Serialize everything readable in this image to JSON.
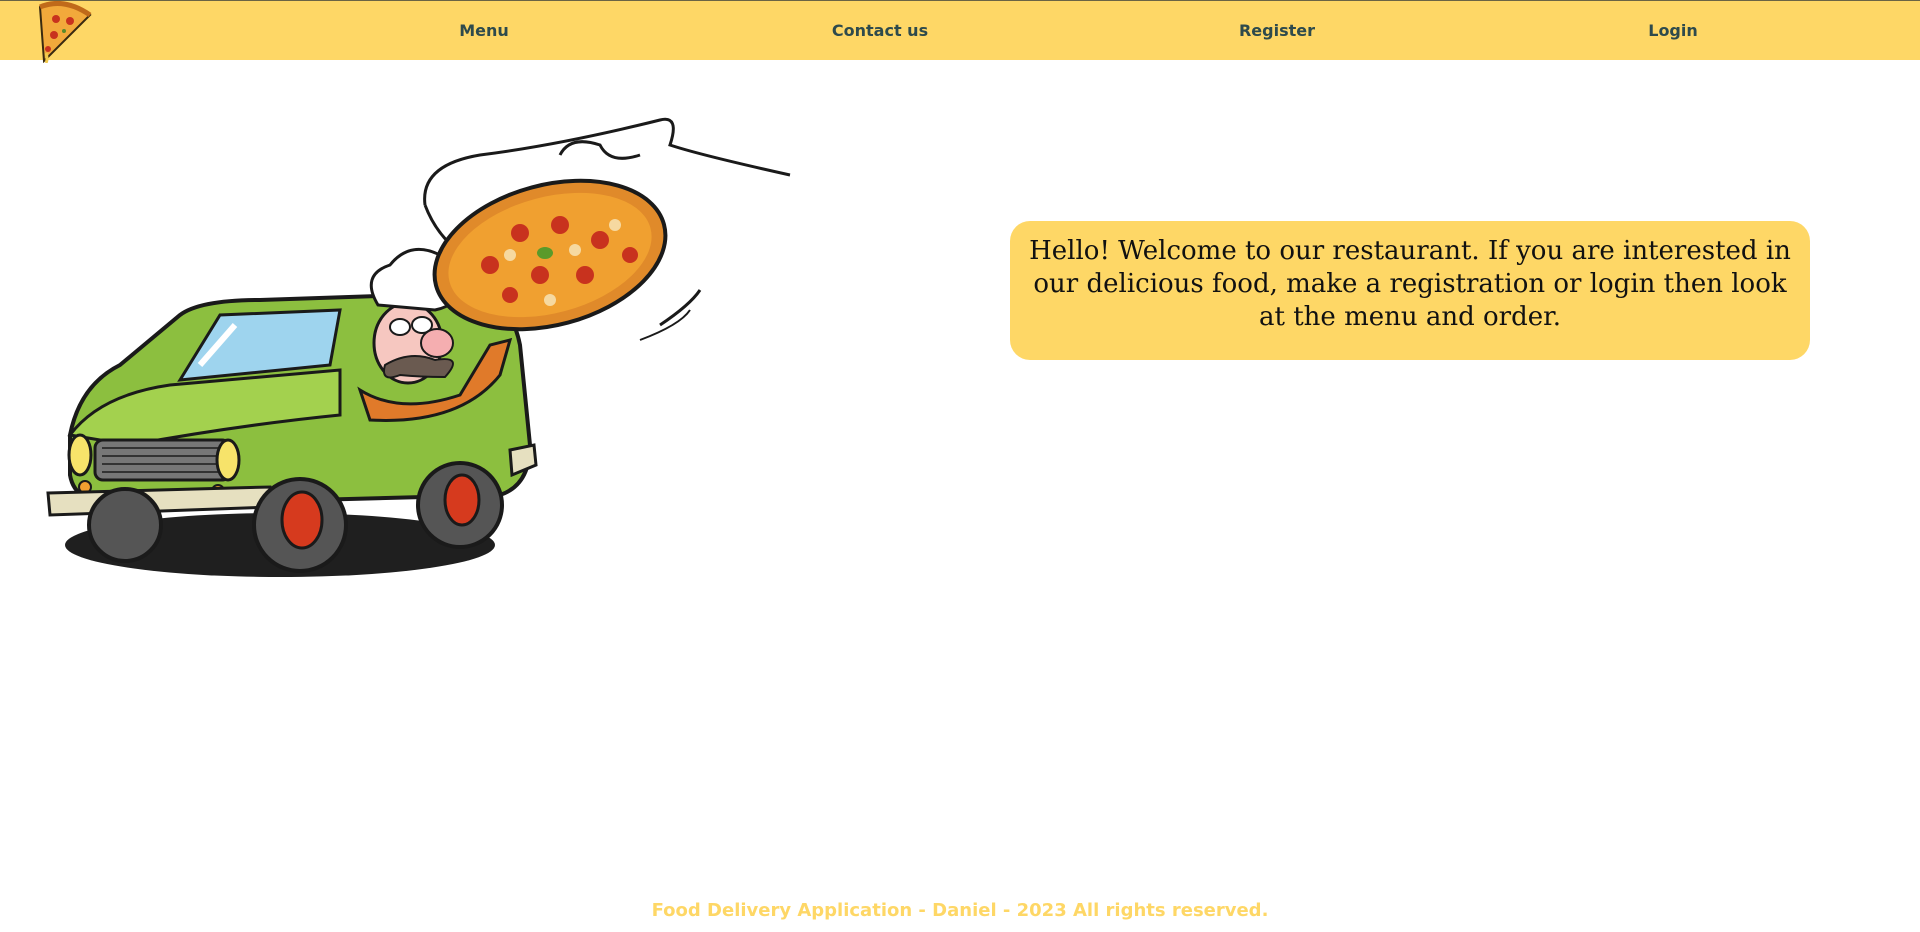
{
  "nav": {
    "items": [
      {
        "label": "Menu"
      },
      {
        "label": "Contact us"
      },
      {
        "label": "Register"
      },
      {
        "label": "Login"
      }
    ],
    "logo_icon": "pizza-slice-icon"
  },
  "hero": {
    "illustration": "pizza-delivery-truck-chef-illustration"
  },
  "welcome": {
    "text": "Hello! Welcome to our restaurant. If you are interested in our delicious food, make a registration or login then look at the menu and order."
  },
  "footer": {
    "text": "Food Delivery Application - Daniel - 2023 All rights reserved."
  },
  "colors": {
    "accent": "#fed766",
    "nav_text": "#2e4a4c",
    "truck_green": "#8cbf3f"
  }
}
